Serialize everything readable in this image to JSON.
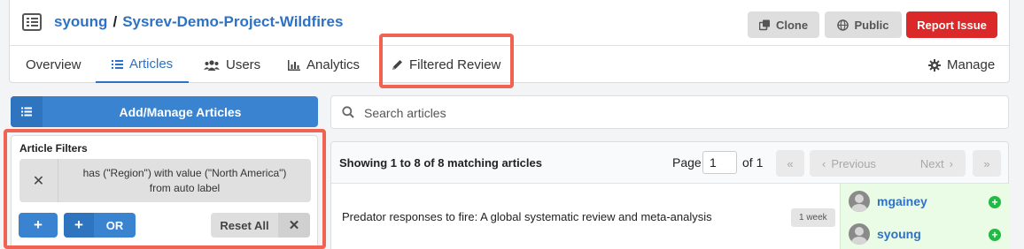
{
  "header": {
    "user": "syoung",
    "separator": "/",
    "project": "Sysrev-Demo-Project-Wildfires",
    "buttons": {
      "clone": "Clone",
      "public": "Public",
      "report": "Report Issue"
    }
  },
  "tabs": [
    {
      "label": "Overview",
      "icon": ""
    },
    {
      "label": "Articles",
      "icon": "list-icon",
      "active": true
    },
    {
      "label": "Users",
      "icon": "users-icon"
    },
    {
      "label": "Analytics",
      "icon": "bar-chart-icon"
    },
    {
      "label": "Filtered Review",
      "icon": "pencil-icon"
    },
    {
      "label": "Manage",
      "icon": "gear-icon"
    }
  ],
  "sidebar": {
    "add_manage": "Add/Manage Articles",
    "filters_title": "Article Filters",
    "filter_line1": "has (\"Region\") with value (\"North America\")",
    "filter_line2": "from auto label",
    "or_label": "OR",
    "reset_label": "Reset All"
  },
  "search": {
    "placeholder": "Search articles"
  },
  "list": {
    "showing": "Showing 1 to 8 of 8 matching articles",
    "page_label": "Page",
    "page_value": "1",
    "of_label": "of 1",
    "prev": "Previous",
    "next": "Next"
  },
  "article": {
    "title": "Predator responses to fire: A global systematic review and meta-analysis",
    "age": "1 week",
    "users": [
      "mgainey",
      "syoung"
    ]
  },
  "colors": {
    "accent": "#2d72c4",
    "danger": "#db2828",
    "highlight": "#f06352",
    "success": "#21ba45"
  }
}
